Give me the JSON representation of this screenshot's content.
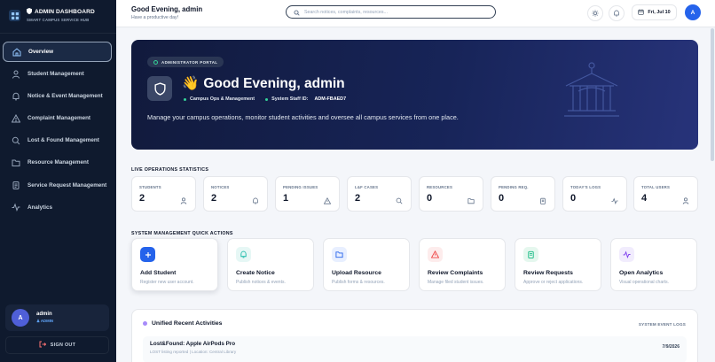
{
  "sidebar": {
    "brand_title": "ADMIN DASHBOARD",
    "brand_subtitle": "SMART CAMPUS SERVICE HUB",
    "items": [
      {
        "label": "Overview",
        "icon": "home-icon",
        "active": true
      },
      {
        "label": "Student Management",
        "icon": "user-icon"
      },
      {
        "label": "Notice & Event Management",
        "icon": "bell-icon"
      },
      {
        "label": "Complaint Management",
        "icon": "warning-icon"
      },
      {
        "label": "Lost & Found Management",
        "icon": "search-icon"
      },
      {
        "label": "Resource Management",
        "icon": "folder-icon"
      },
      {
        "label": "Service Request Management",
        "icon": "clipboard-icon"
      },
      {
        "label": "Analytics",
        "icon": "activity-icon"
      }
    ],
    "user": {
      "avatar": "A",
      "name": "admin",
      "role": "ADMIN"
    },
    "signout": "SIGN OUT"
  },
  "header": {
    "title": "Good Evening, admin",
    "subtitle": "Have a productive day!",
    "search_placeholder": "Search notices, complaints, resources...",
    "date": "Fri, Jul 10",
    "avatar": "A"
  },
  "hero": {
    "badge": "ADMINISTRATOR PORTAL",
    "emoji": "👋",
    "title": "Good Evening, admin",
    "meta_1": "Campus Ops & Management",
    "meta_2_label": "System Staff ID:",
    "meta_2_value": "ADM-FBAED7",
    "description": "Manage your campus operations, monitor student activities and oversee all campus services from one place."
  },
  "stats_label": "LIVE OPERATIONS STATISTICS",
  "stats": [
    {
      "label": "STUDENTS",
      "value": "2",
      "icon": "user-icon"
    },
    {
      "label": "NOTICES",
      "value": "2",
      "icon": "bell-icon"
    },
    {
      "label": "PENDING ISSUES",
      "value": "1",
      "icon": "warning-icon"
    },
    {
      "label": "L&F CASES",
      "value": "2",
      "icon": "search-icon"
    },
    {
      "label": "RESOURCES",
      "value": "0",
      "icon": "folder-icon"
    },
    {
      "label": "PENDING REQ.",
      "value": "0",
      "icon": "clipboard-icon"
    },
    {
      "label": "TODAY'S LOGS",
      "value": "0",
      "icon": "activity-icon"
    },
    {
      "label": "TOTAL USERS",
      "value": "4",
      "icon": "user-icon"
    }
  ],
  "actions_label": "SYSTEM MANAGEMENT QUICK ACTIONS",
  "actions": [
    {
      "title": "Add Student",
      "subtitle": "Register new user account.",
      "icon": "plus-icon",
      "color": "#2563eb"
    },
    {
      "title": "Create Notice",
      "subtitle": "Publish notices & events.",
      "icon": "bell-icon",
      "color": "#14b8a6"
    },
    {
      "title": "Upload Resource",
      "subtitle": "Publish forms & resources.",
      "icon": "folder-icon",
      "color": "#2563eb"
    },
    {
      "title": "Review Complaints",
      "subtitle": "Manage filed student issues.",
      "icon": "warning-icon",
      "color": "#ef4444"
    },
    {
      "title": "Review Requests",
      "subtitle": "Approve or reject applications.",
      "icon": "clipboard-icon",
      "color": "#10b981"
    },
    {
      "title": "Open Analytics",
      "subtitle": "Visual operational charts.",
      "icon": "activity-icon",
      "color": "#7c3aed"
    }
  ],
  "activity": {
    "title": "Unified Recent Activities",
    "link": "SYSTEM EVENT LOGS",
    "rows": [
      {
        "title": "Lost&Found: Apple AirPods Pro",
        "subtitle": "LOST listing reported | Location: Central Library",
        "date": "7/9/2026"
      }
    ]
  }
}
